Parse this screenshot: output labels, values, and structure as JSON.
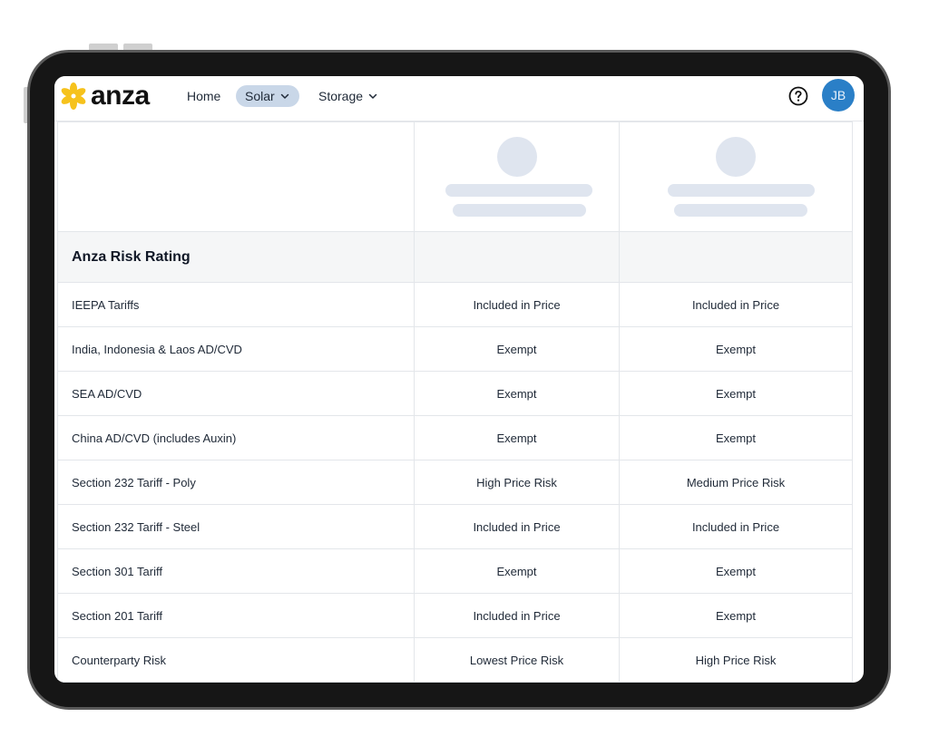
{
  "brand": {
    "name": "anza",
    "accent": "#f6c21c"
  },
  "nav": {
    "items": [
      {
        "label": "Home",
        "active": false,
        "has_dropdown": false
      },
      {
        "label": "Solar",
        "active": true,
        "has_dropdown": true
      },
      {
        "label": "Storage",
        "active": false,
        "has_dropdown": true
      }
    ],
    "help_icon": "question-circle-icon",
    "avatar_initials": "JB",
    "avatar_color": "#2a7fc7"
  },
  "table": {
    "section_title": "Anza Risk Rating",
    "rows": [
      {
        "label": "IEEPA Tariffs",
        "values": [
          "Included in Price",
          "Included in Price"
        ]
      },
      {
        "label": "India, Indonesia & Laos AD/CVD",
        "values": [
          "Exempt",
          "Exempt"
        ]
      },
      {
        "label": "SEA AD/CVD",
        "values": [
          "Exempt",
          "Exempt"
        ]
      },
      {
        "label": "China AD/CVD (includes Auxin)",
        "values": [
          "Exempt",
          "Exempt"
        ]
      },
      {
        "label": "Section 232 Tariff - Poly",
        "values": [
          "High Price Risk",
          "Medium Price Risk"
        ]
      },
      {
        "label": "Section 232 Tariff - Steel",
        "values": [
          "Included in Price",
          "Included in Price"
        ]
      },
      {
        "label": "Section 301 Tariff",
        "values": [
          "Exempt",
          "Exempt"
        ]
      },
      {
        "label": "Section 201 Tariff",
        "values": [
          "Included in Price",
          "Exempt"
        ]
      },
      {
        "label": "Counterparty Risk",
        "values": [
          "Lowest Price Risk",
          "High Price Risk"
        ]
      }
    ]
  }
}
